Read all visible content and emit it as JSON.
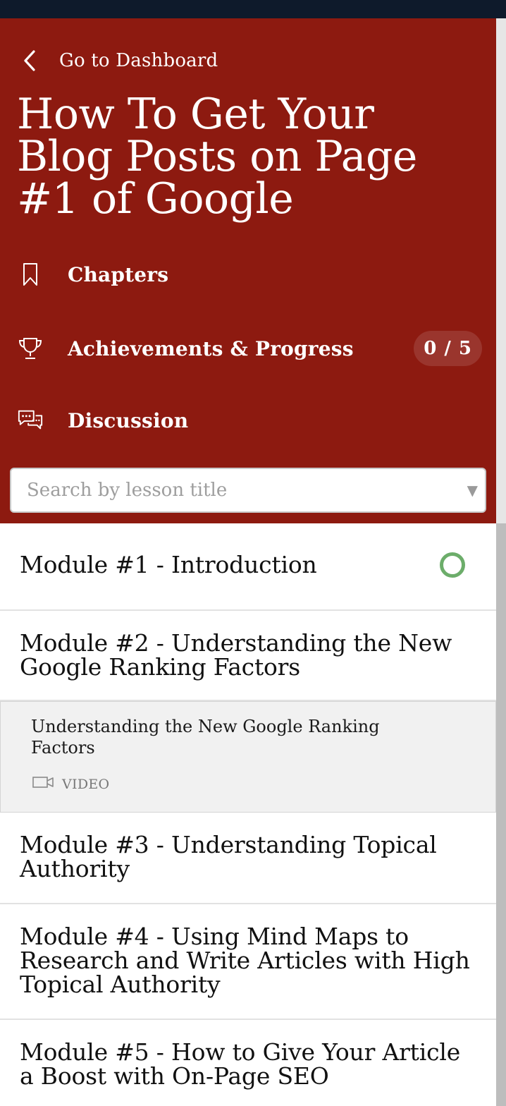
{
  "header": {
    "back_label": "Go to Dashboard",
    "course_title": "How To Get Your Blog Posts on Page #1 of Google"
  },
  "nav": {
    "chapters_label": "Chapters",
    "achievements_label": "Achievements & Progress",
    "achievements_badge": "0 / 5",
    "discussion_label": "Discussion"
  },
  "search": {
    "placeholder": "Search by lesson title",
    "value": ""
  },
  "modules": [
    {
      "title": "Module #1 - Introduction"
    },
    {
      "title": "Module #2 - Understanding the New Google Ranking Factors"
    },
    {
      "title": "Module #3 - Understanding Topical Authority"
    },
    {
      "title": "Module #4 - Using Mind Maps to Research and Write Articles with High Topical Authority"
    },
    {
      "title": "Module #5 - How to Give Your Article a Boost with On-Page SEO"
    }
  ],
  "lesson": {
    "title": "Understanding the New Google Ranking Factors",
    "type_label": "VIDEO"
  },
  "colors": {
    "header_bg": "#8d1a10",
    "topbar_bg": "#0e1a2b",
    "status_ring": "#6cad6a"
  },
  "icons": {
    "back": "chevron-left-icon",
    "chapters": "bookmark-icon",
    "achievements": "trophy-icon",
    "discussion": "chat-bubbles-icon",
    "lesson_type": "video-camera-icon",
    "select": "caret-down-icon"
  }
}
